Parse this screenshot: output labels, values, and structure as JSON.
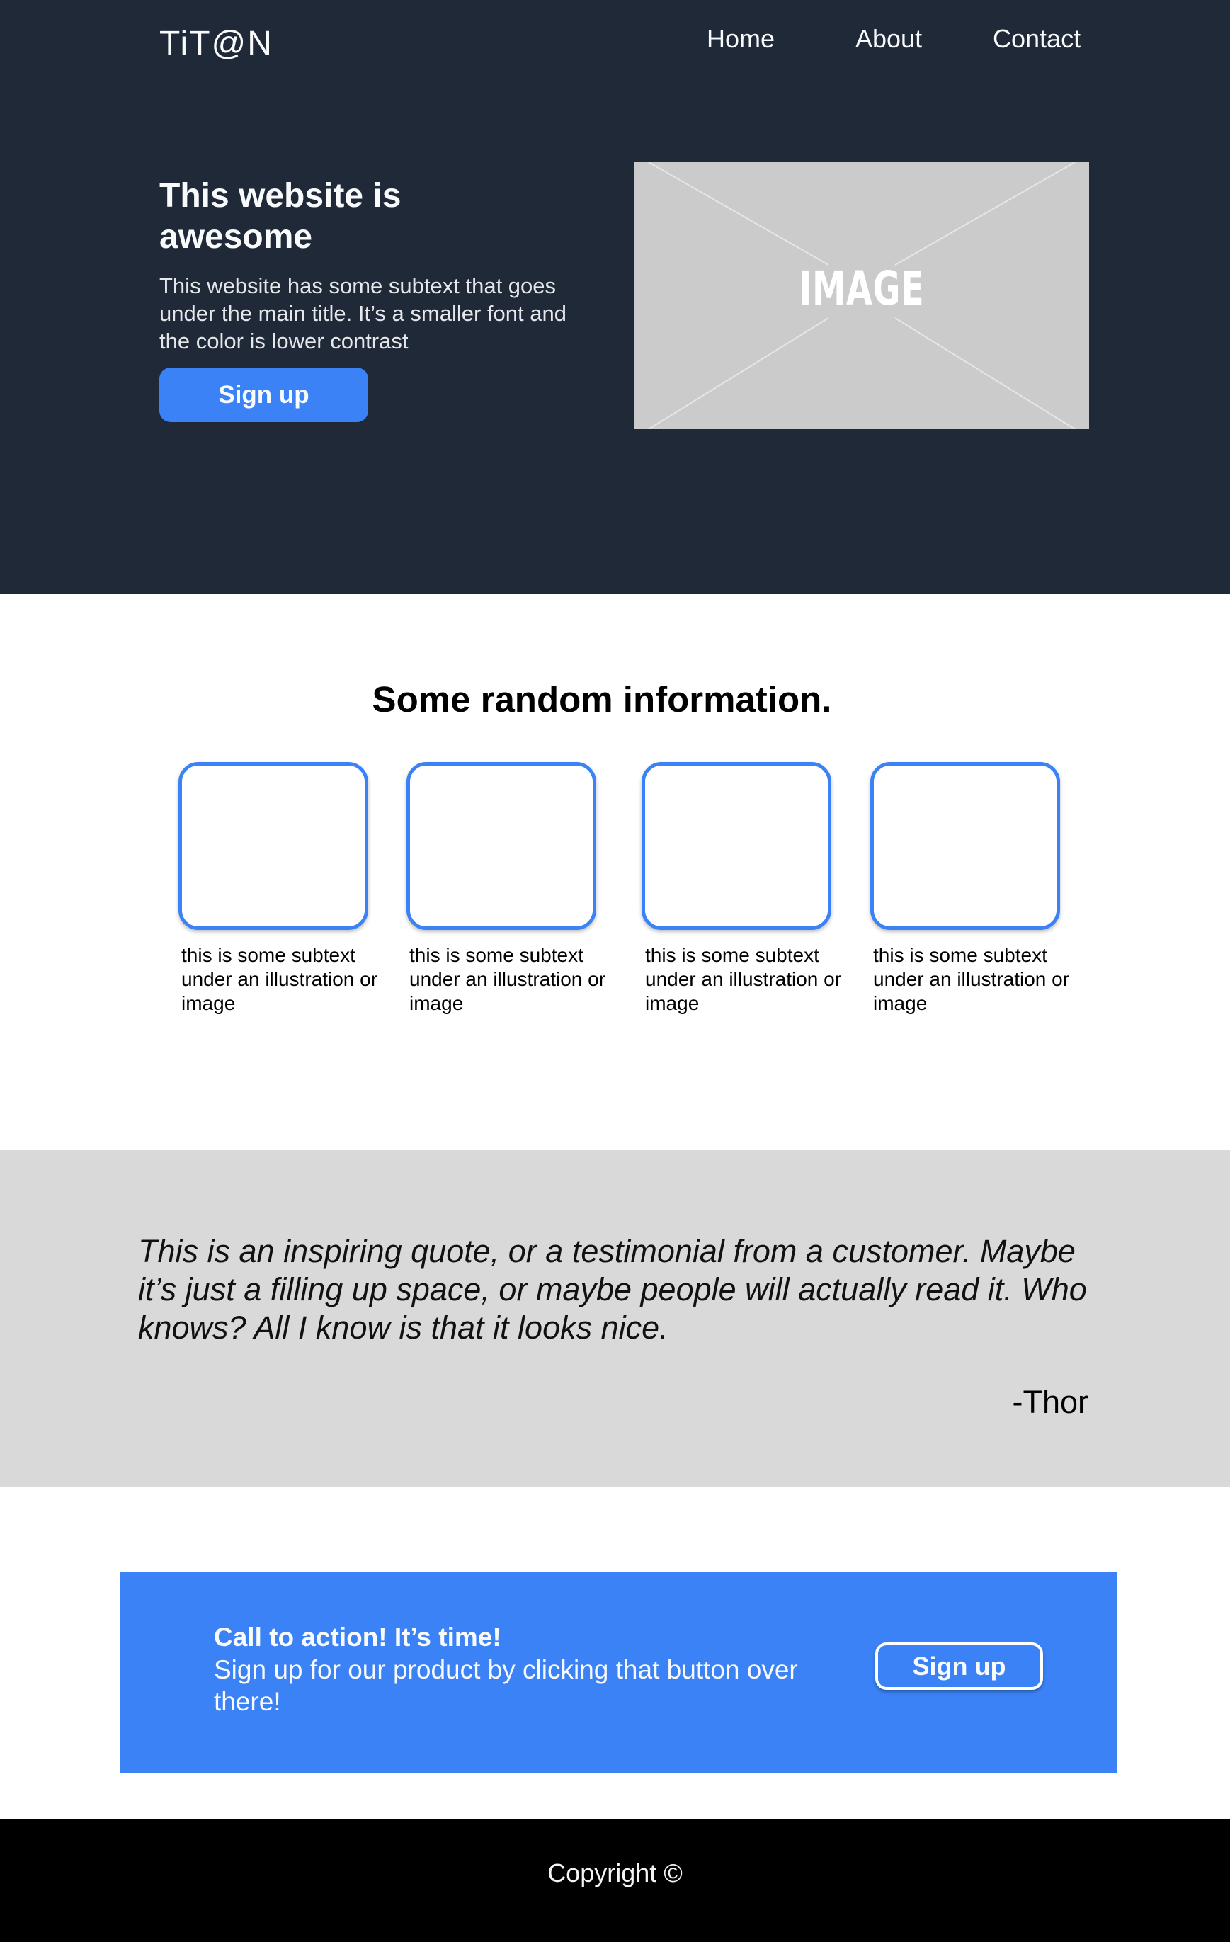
{
  "header": {
    "logo": "TiT@N",
    "nav": [
      "Home",
      "About",
      "Contact"
    ]
  },
  "hero": {
    "title": "This website is awesome",
    "subtitle": "This website  has some subtext that goes under the main title. It’s a smaller font and the color is lower contrast",
    "button_label": "Sign up",
    "image_label": "IMAGE"
  },
  "info": {
    "title": "Some random information.",
    "cards": [
      {
        "caption": "this is some subtext under an illustration or image"
      },
      {
        "caption": "this is some subtext under an illustration or image"
      },
      {
        "caption": "this is some subtext under an illustration or image"
      },
      {
        "caption": "this is some subtext under an illustration or image"
      }
    ]
  },
  "quote": {
    "text": "This is an inspiring quote, or a testimonial from a customer. Maybe it’s just a filling up space, or maybe people will actually read it. Who knows? All I know is that it looks nice.",
    "author": "-Thor"
  },
  "cta": {
    "title": "Call to action! It’s time!",
    "subtitle": "Sign up for our product by clicking that button over there!",
    "button_label": "Sign up"
  },
  "footer": {
    "copyright": "Copyright ©"
  },
  "colors": {
    "hero_bg": "#1f2937",
    "accent": "#3b82f6",
    "quote_bg": "#d9d9d9",
    "footer_bg": "#000000"
  }
}
